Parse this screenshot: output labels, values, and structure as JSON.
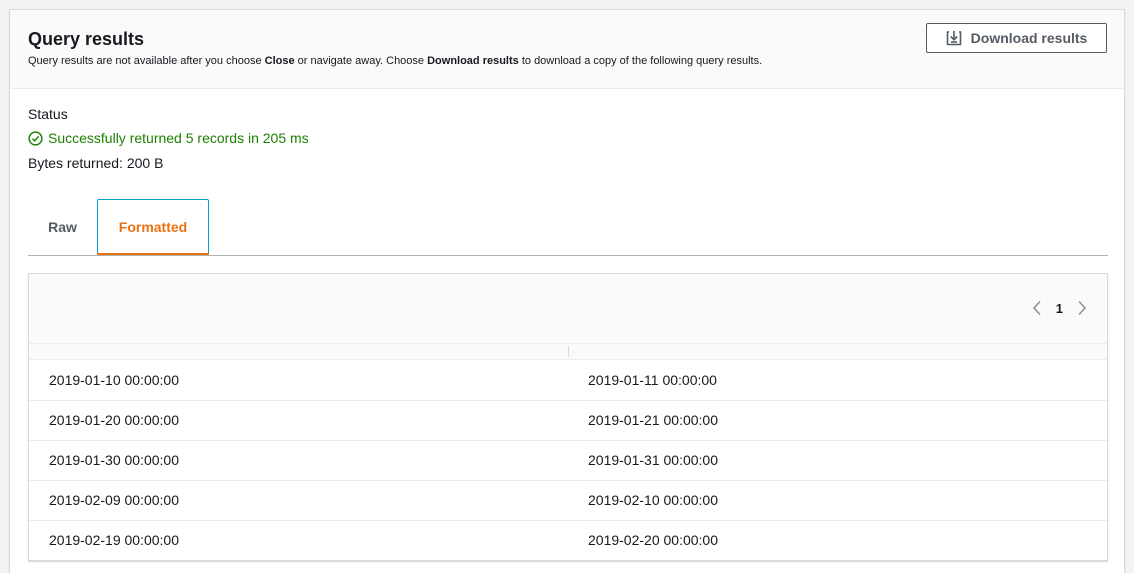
{
  "header": {
    "title": "Query results",
    "desc_before_close": "Query results are not available after you choose ",
    "desc_close": "Close",
    "desc_middle": " or navigate away. Choose ",
    "desc_download": "Download results",
    "desc_after": " to download a copy of the following query results.",
    "download_button_label": "Download results"
  },
  "status": {
    "label": "Status",
    "message": "Successfully returned 5 records in 205 ms",
    "bytes": "Bytes returned: 200 B"
  },
  "tabs": [
    {
      "label": "Raw",
      "selected": false
    },
    {
      "label": "Formatted",
      "selected": true
    }
  ],
  "pagination": {
    "current_page": "1"
  },
  "table": {
    "rows": [
      [
        "2019-01-10 00:00:00",
        "2019-01-11 00:00:00"
      ],
      [
        "2019-01-20 00:00:00",
        "2019-01-21 00:00:00"
      ],
      [
        "2019-01-30 00:00:00",
        "2019-01-31 00:00:00"
      ],
      [
        "2019-02-09 00:00:00",
        "2019-02-10 00:00:00"
      ],
      [
        "2019-02-19 00:00:00",
        "2019-02-20 00:00:00"
      ]
    ]
  },
  "colors": {
    "success": "#1d8102",
    "tab_active": "#ec7211",
    "tab_focus": "#00a1c9"
  },
  "icons": {
    "download": "download-icon",
    "status": "check-circle-icon",
    "prev": "chevron-left-icon",
    "next": "chevron-right-icon"
  }
}
